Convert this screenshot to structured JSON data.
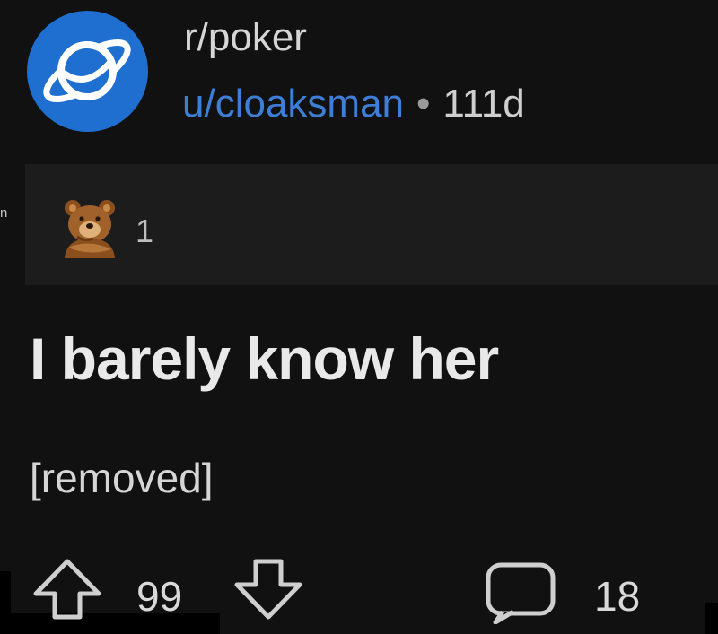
{
  "edge_fragment": "n",
  "post": {
    "subreddit": "r/poker",
    "username": "u/cloaksman",
    "separator": "•",
    "age": "111d",
    "award_count": "1",
    "title": "I barely know her",
    "body": "[removed]",
    "votes": "99",
    "comments": "18"
  },
  "icons": {
    "subreddit_avatar": "planet-icon",
    "award": "bear-award-icon",
    "upvote": "upvote-arrow-icon",
    "downvote": "downvote-arrow-icon",
    "comment": "comment-bubble-icon"
  },
  "colors": {
    "background": "#111112",
    "award_bar": "#1c1c1d",
    "avatar_blue": "#1f6fd0",
    "username_blue": "#3d7fd6",
    "title_text": "#e9e9e9"
  }
}
